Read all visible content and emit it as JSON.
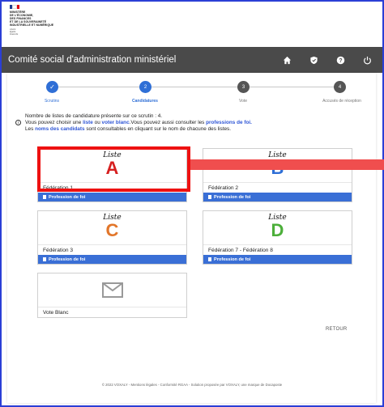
{
  "logo": {
    "lines": [
      "MINISTÈRE",
      "DE L'ÉCONOMIE,",
      "DES FINANCES",
      "ET DE LA SOUVERAINETÉ",
      "INDUSTRIELLE ET NUMÉRIQUE"
    ],
    "motto": [
      "Liberté",
      "Égalité",
      "Fraternité"
    ]
  },
  "header": {
    "title": "Comité social d'administration ministériel",
    "icons": [
      "home-icon",
      "shield-icon",
      "help-icon",
      "power-icon"
    ]
  },
  "stepper": {
    "steps": [
      {
        "number": "✓",
        "label": "Scrutins",
        "state": "done"
      },
      {
        "number": "2",
        "label": "Candidatures",
        "state": "active"
      },
      {
        "number": "3",
        "label": "Vote",
        "state": "todo"
      },
      {
        "number": "4",
        "label": "Accusés de réception",
        "state": "todo"
      }
    ]
  },
  "info": {
    "line1": "Nombre de listes de candidature présente sur ce scrutin : 4.",
    "line2_a": "Vous pouvez choisir une ",
    "line2_liste": "liste",
    "line2_b": " ou ",
    "line2_voter": "voter blanc",
    "line2_c": ".Vous pouvez aussi consulter les ",
    "line2_prof": "professions de foi.",
    "line3_a": "Les ",
    "line3_noms": "noms des candidats",
    "line3_b": " sont consultables en cliquant sur le nom de chacune des listes."
  },
  "lists": [
    {
      "liste": "Liste",
      "letter": "A",
      "color": "#d62020",
      "name": "Fédération 1",
      "pdf": "Profession de foi"
    },
    {
      "liste": "Liste",
      "letter": "B",
      "color": "#2f6fd6",
      "name": "Fédération 2",
      "pdf": "Profession de foi"
    },
    {
      "liste": "Liste",
      "letter": "C",
      "color": "#e2762a",
      "name": "Fédération 3",
      "pdf": "Profession de foi"
    },
    {
      "liste": "Liste",
      "letter": "D",
      "color": "#4caf3a",
      "name": "Fédération 7 - Fédération 8",
      "pdf": "Profession de foi"
    }
  ],
  "blank": {
    "label": "Vote Blanc"
  },
  "retour": "RETOUR",
  "footer": "© 2022 VOXALY - Mentions légales - Conformité RGAA - Solution proposée par VOXALY, une marque de Docaposte",
  "colors": {
    "header": "#4a4a4a",
    "accent": "#3a6fd6",
    "step_active": "#2f6fd6",
    "step_todo": "#555555",
    "highlight": "#e11111"
  }
}
